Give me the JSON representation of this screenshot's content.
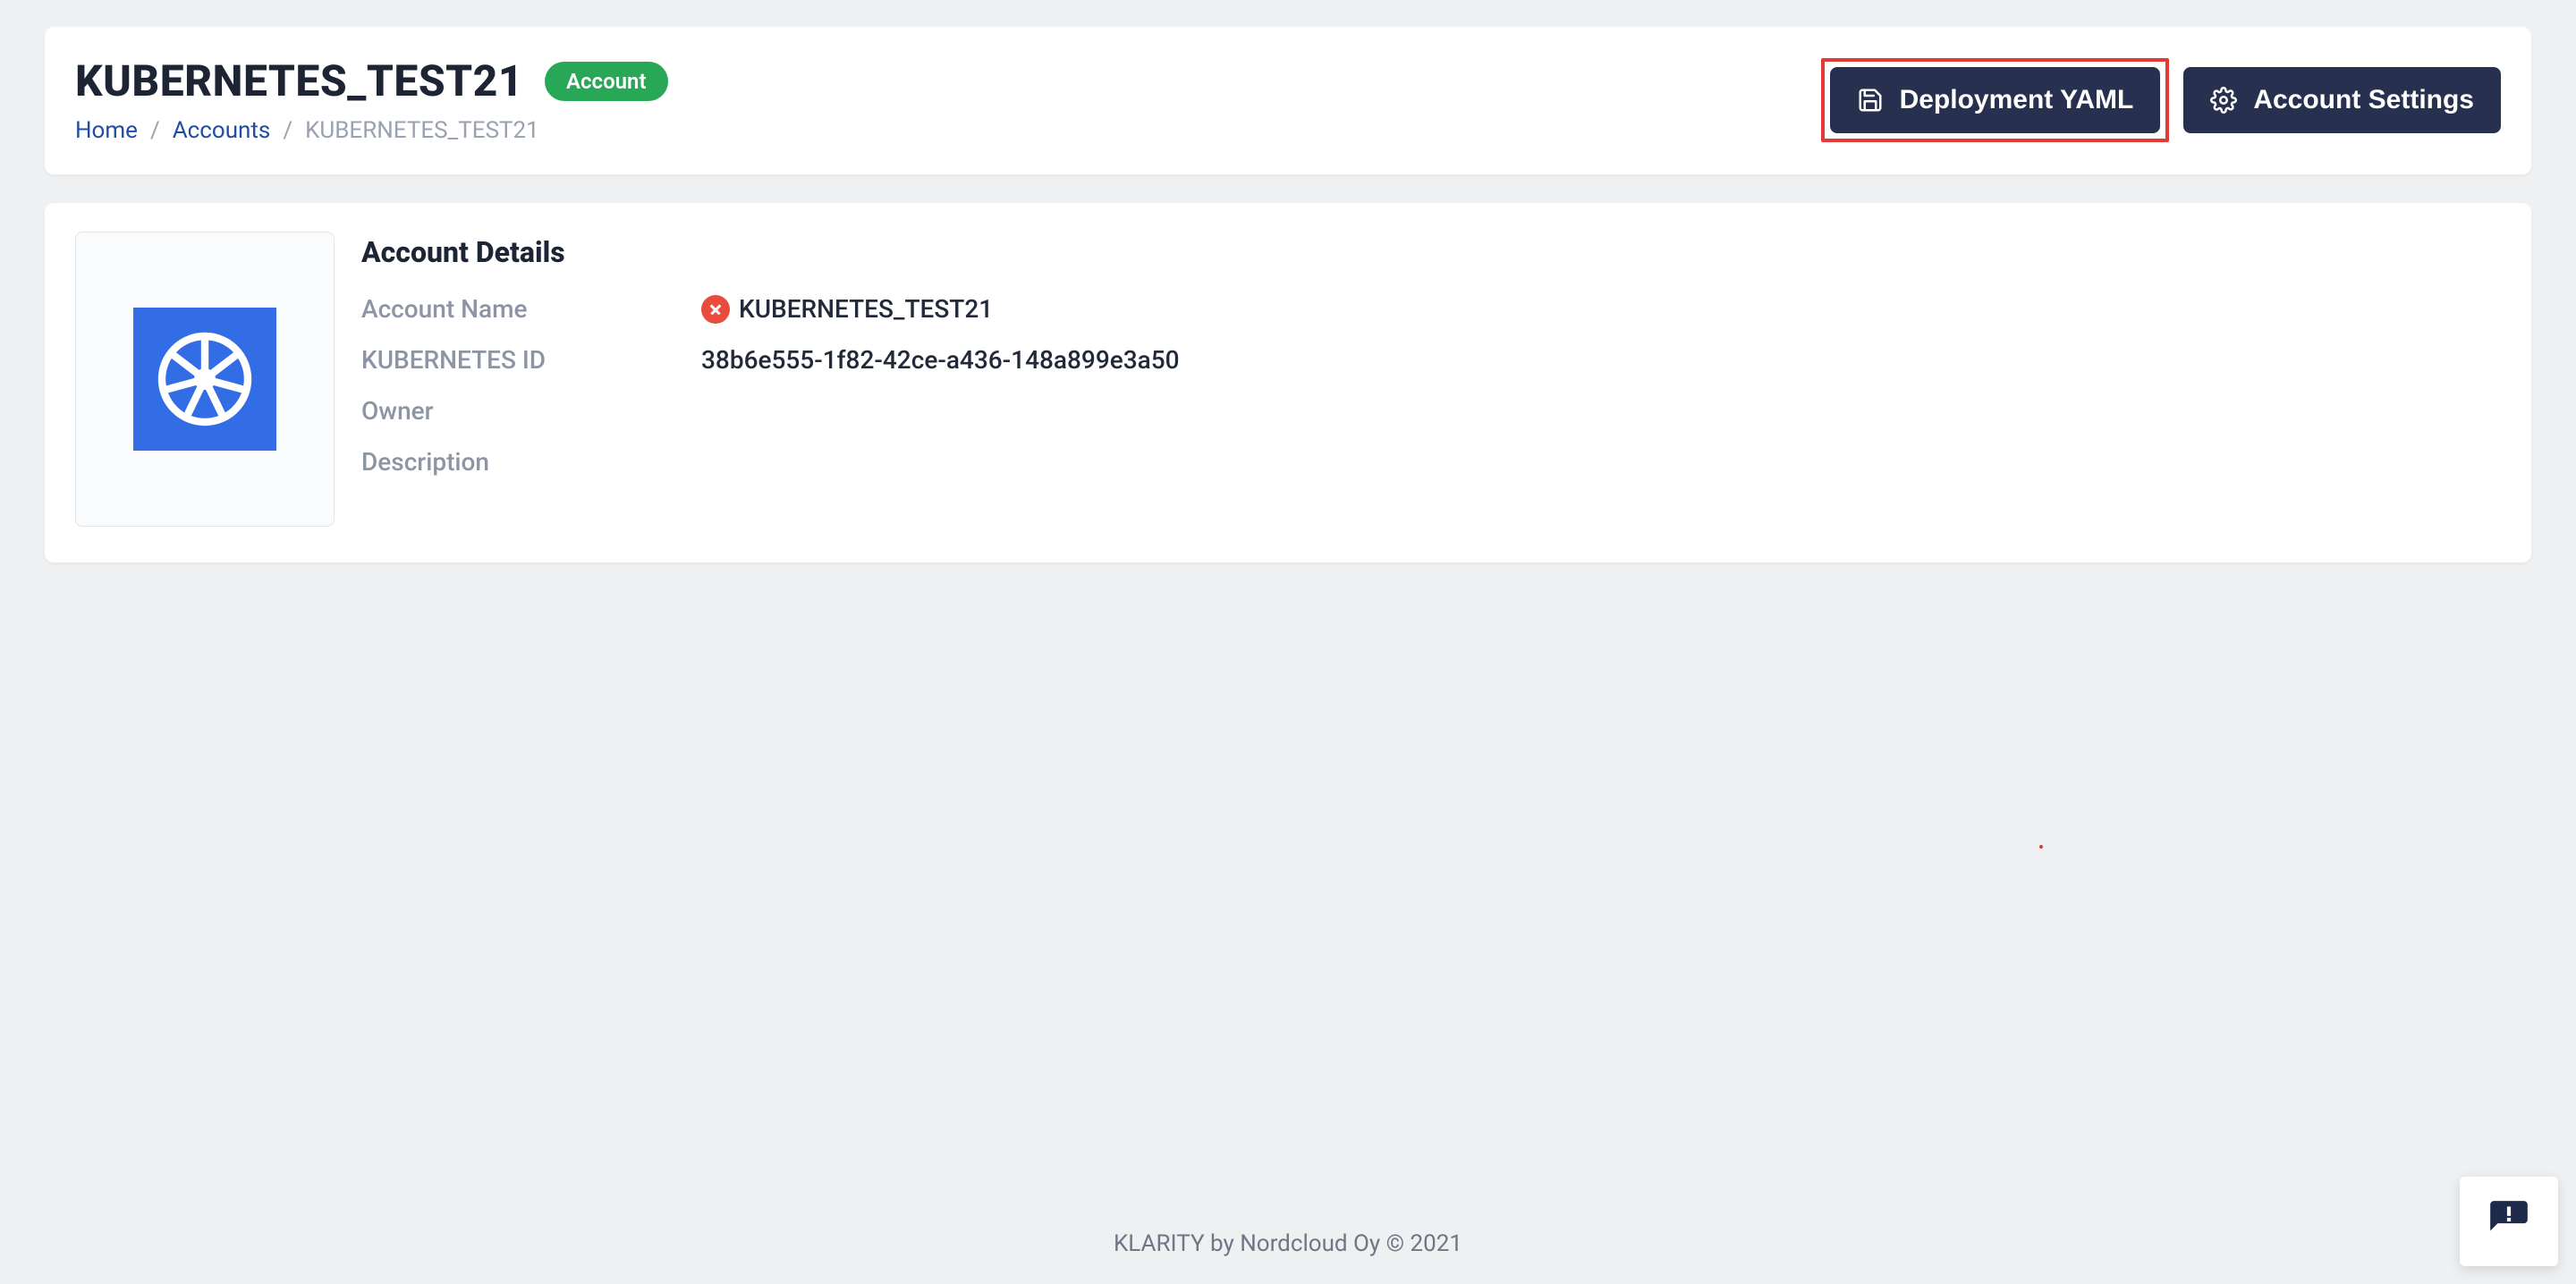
{
  "header": {
    "title": "KUBERNETES_TEST21",
    "badge": "Account",
    "breadcrumb": {
      "home": "Home",
      "accounts": "Accounts",
      "current": "KUBERNETES_TEST21"
    },
    "buttons": {
      "deployment_yaml": "Deployment YAML",
      "account_settings": "Account Settings"
    }
  },
  "details": {
    "heading": "Account Details",
    "fields": {
      "account_name_label": "Account Name",
      "account_name_value": "KUBERNETES_TEST21",
      "kubernetes_id_label": "KUBERNETES ID",
      "kubernetes_id_value": "38b6e555-1f82-42ce-a436-148a899e3a50",
      "owner_label": "Owner",
      "owner_value": "",
      "description_label": "Description",
      "description_value": ""
    }
  },
  "footer": {
    "text": "KLARITY by Nordcloud Oy © 2021"
  }
}
